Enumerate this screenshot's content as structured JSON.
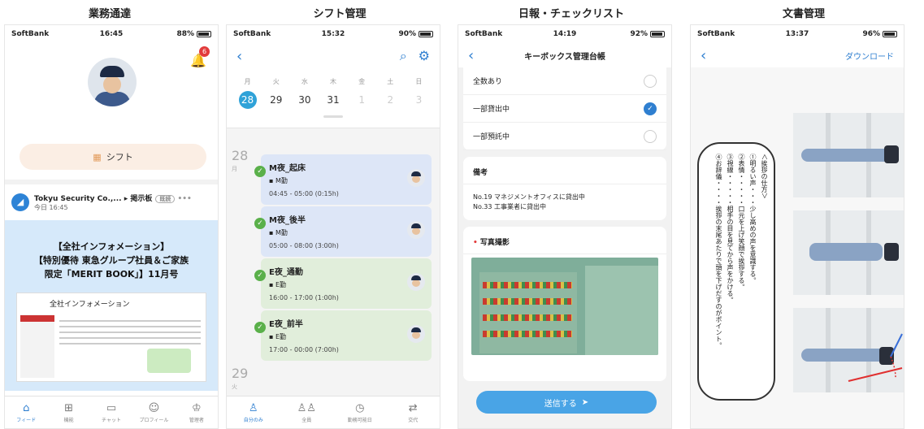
{
  "captions": [
    "業務通達",
    "シフト管理",
    "日報・チェックリスト",
    "文書管理"
  ],
  "p1": {
    "carrier": "SoftBank",
    "time": "16:45",
    "battery": "88%",
    "badge": "6",
    "shift_label": "シフト",
    "org": "Tokyu Security Co.,...",
    "board": "掲示板",
    "read": "既読",
    "date": "今日 16:45",
    "banner": [
      "【全社インフォメーション】",
      "【特別優待 東急グループ社員＆ご家族",
      "限定「MERIT BOOK」】11月号"
    ],
    "doc_title": "全社インフォメーション",
    "tabs": [
      "フィード",
      "機能",
      "チャット",
      "プロフィール",
      "管理者"
    ]
  },
  "p2": {
    "carrier": "SoftBank",
    "time": "15:32",
    "battery": "90%",
    "weekdays": [
      "月",
      "火",
      "水",
      "木",
      "金",
      "土",
      "日"
    ],
    "dates": [
      "28",
      "29",
      "30",
      "31",
      "1",
      "2",
      "3"
    ],
    "day1": "28",
    "day1_sub": "月",
    "day2": "29",
    "day2_sub": "火",
    "shifts": [
      {
        "title": "M夜_起床",
        "type": "M勤",
        "time": "04:45 - 05:00 (0:15h)"
      },
      {
        "title": "M夜_後半",
        "type": "M勤",
        "time": "05:00 - 08:00 (3:00h)"
      },
      {
        "title": "E夜_通勤",
        "type": "E勤",
        "time": "16:00 - 17:00 (1:00h)"
      },
      {
        "title": "E夜_前半",
        "type": "E勤",
        "time": "17:00 - 00:00 (7:00h)"
      }
    ],
    "tabs": [
      "自分のみ",
      "全員",
      "勤務可能日",
      "交代"
    ]
  },
  "p3": {
    "carrier": "SoftBank",
    "time": "14:19",
    "battery": "92%",
    "title": "キーボックス管理台帳",
    "options": [
      "全数あり",
      "一部貸出中",
      "一部預託中"
    ],
    "remarks_h": "備考",
    "remarks": [
      "No.19 マネジメントオフィスに貸出中",
      "No.33 工事業者に貸出中"
    ],
    "photo_h": "写真撮影",
    "required": "•",
    "send": "送信する"
  },
  "p4": {
    "carrier": "SoftBank",
    "time": "13:37",
    "battery": "96%",
    "download": "ダウンロード",
    "lines": [
      "＜挨拶の仕方＞",
      "①明るい声・・・少し高めの声を意識する。",
      "②表情・・・・・口元を上げ笑顔で挨拶する。",
      "③視線・・・・・相手の目を見てから声をかける。",
      "④お辞儀・・・・挨拶の末尾あたりで頭を下げだすのがポイント。"
    ]
  }
}
